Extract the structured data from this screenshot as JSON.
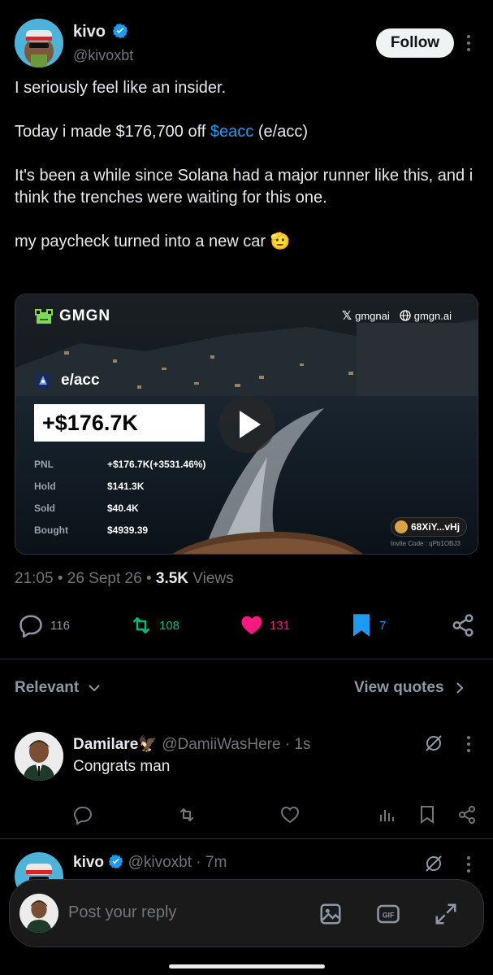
{
  "tweet": {
    "author_name": "kivo",
    "author_handle": "@kivoxbt",
    "follow_label": "Follow",
    "lines": [
      "I seriously feel like an insider.",
      "Today i made $176,700 off ",
      "$eacc",
      " (e/acc)",
      "It's been a while since Solana had a major runner like this, and i think the trenches were waiting for this one.",
      "my paycheck turned into a new car 🫡"
    ],
    "time": "21:05 • 26 Sept 26 • ",
    "views_count": "3.5K",
    "views_label": " Views"
  },
  "card": {
    "brand": "GMGN",
    "x_handle": "gmgnai",
    "site": "gmgn.ai",
    "token": "e/acc",
    "headline": "+$176.7K",
    "rows": [
      {
        "label": "PNL",
        "value": "+$176.7K(+3531.46%)"
      },
      {
        "label": "Hold",
        "value": "$141.3K"
      },
      {
        "label": "Sold",
        "value": "$40.4K"
      },
      {
        "label": "Bought",
        "value": "$4939.39"
      }
    ],
    "wallet": "68XiY...vHj",
    "invite": "Invite Code : qPb1OBJ3"
  },
  "actions": {
    "replies": "116",
    "reposts": "108",
    "likes": "131",
    "bookmarks": "7"
  },
  "filter": {
    "label": "Relevant",
    "quotes": "View quotes"
  },
  "reply1": {
    "name": "Damilare🦅",
    "handle": "@DamiiWasHere · 1s",
    "text": "Congrats man"
  },
  "reply2": {
    "name": "kivo",
    "handle": "@kivoxbt · 7m"
  },
  "composer": {
    "placeholder": "Post your reply"
  },
  "colors": {
    "accent": "#1d9bf0",
    "retweet": "#00ba7c",
    "like": "#f91880",
    "background": "#000000"
  }
}
